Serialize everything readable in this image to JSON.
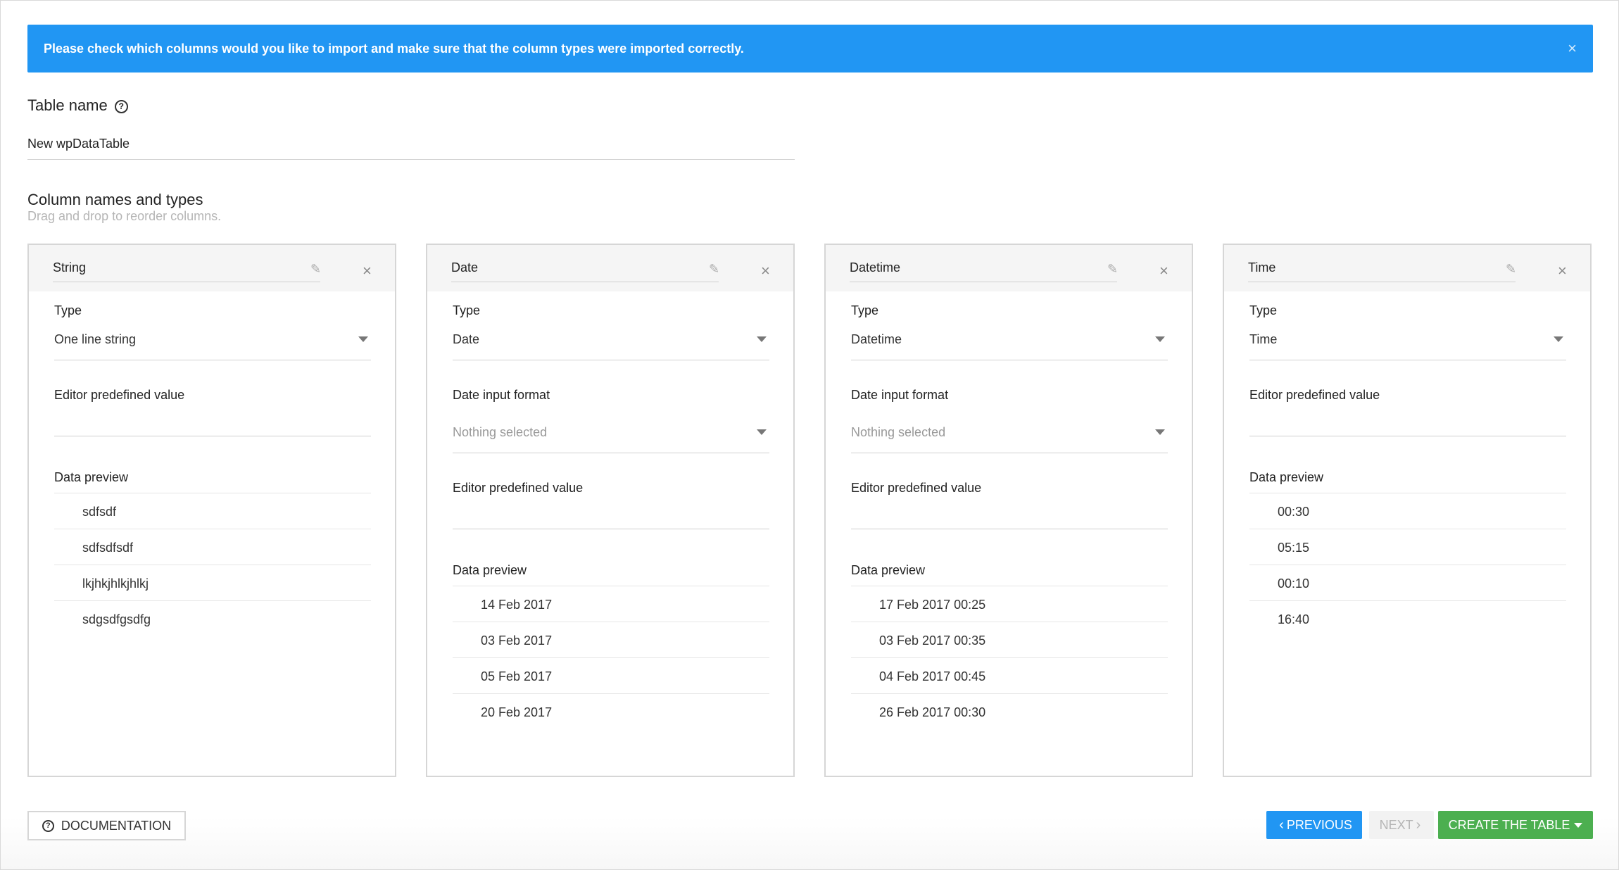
{
  "alert": {
    "message": "Please check which columns would you like to import and make sure that the column types were imported correctly.",
    "close_icon": "×"
  },
  "table_name": {
    "label": "Table name",
    "help_icon": "?",
    "value": "New wpDataTable"
  },
  "columns_section": {
    "title": "Column names and types",
    "subtitle": "Drag and drop to reorder columns."
  },
  "columns": [
    {
      "name": "String",
      "type_label": "Type",
      "type_value": "One line string",
      "predefined_label": "Editor predefined value",
      "preview_label": "Data preview",
      "preview": [
        "sdfsdf",
        "sdfsdfsdf",
        "lkjhkjhlkjhlkj",
        "sdgsdfgsdfg"
      ]
    },
    {
      "name": "Date",
      "type_label": "Type",
      "type_value": "Date",
      "format_label": "Date input format",
      "format_value": "Nothing selected",
      "predefined_label": "Editor predefined value",
      "preview_label": "Data preview",
      "preview": [
        "14 Feb 2017",
        "03 Feb 2017",
        "05 Feb 2017",
        "20 Feb 2017"
      ]
    },
    {
      "name": "Datetime",
      "type_label": "Type",
      "type_value": "Datetime",
      "format_label": "Date input format",
      "format_value": "Nothing selected",
      "predefined_label": "Editor predefined value",
      "preview_label": "Data preview",
      "preview": [
        "17 Feb 2017 00:25",
        "03 Feb 2017 00:35",
        "04 Feb 2017 00:45",
        "26 Feb 2017 00:30"
      ]
    },
    {
      "name": "Time",
      "type_label": "Type",
      "type_value": "Time",
      "predefined_label": "Editor predefined value",
      "preview_label": "Data preview",
      "preview": [
        "00:30",
        "05:15",
        "00:10",
        "16:40"
      ]
    }
  ],
  "icons": {
    "pencil": "✎",
    "close": "×"
  },
  "footer": {
    "documentation": "DOCUMENTATION",
    "previous": "PREVIOUS",
    "next": "NEXT",
    "create": "CREATE THE TABLE"
  },
  "colors": {
    "alert": "#2196f3",
    "primary_button": "#2196f3",
    "create_button": "#4caf50"
  }
}
